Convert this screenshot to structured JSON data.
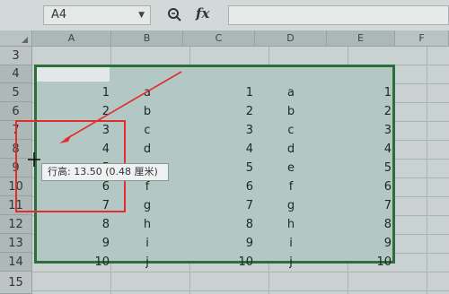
{
  "formula_bar": {
    "name_box_value": "A4",
    "fx_label": "fx",
    "formula_value": ""
  },
  "columns": [
    "A",
    "B",
    "C",
    "D",
    "E",
    "F"
  ],
  "rows": [
    "3",
    "4",
    "5",
    "6",
    "7",
    "8",
    "9",
    "10",
    "11",
    "12",
    "13",
    "14",
    "15"
  ],
  "table": [
    [
      "1",
      "a",
      "1",
      "a",
      "1"
    ],
    [
      "2",
      "b",
      "2",
      "b",
      "2"
    ],
    [
      "3",
      "c",
      "3",
      "c",
      "3"
    ],
    [
      "4",
      "d",
      "4",
      "d",
      "4"
    ],
    [
      "5",
      "e",
      "5",
      "e",
      "5"
    ],
    [
      "6",
      "f",
      "6",
      "f",
      "6"
    ],
    [
      "7",
      "g",
      "7",
      "g",
      "7"
    ],
    [
      "8",
      "h",
      "8",
      "h",
      "8"
    ],
    [
      "9",
      "i",
      "9",
      "i",
      "9"
    ],
    [
      "10",
      "j",
      "10",
      "j",
      "10"
    ]
  ],
  "tooltip": {
    "text": "行高: 13.50 (0.48 厘米)"
  },
  "colors": {
    "selection_border": "#2c6e3c",
    "annotation_red": "#e22d2d"
  }
}
